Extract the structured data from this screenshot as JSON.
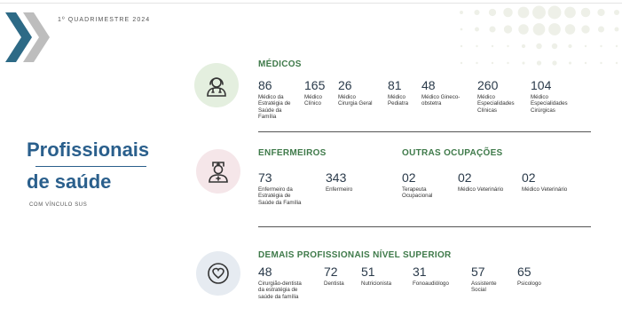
{
  "header": {
    "period": "1º QUADRIMESTRE 2024"
  },
  "title": {
    "line1": "Profissionais",
    "line2": "de saúde",
    "subtitle": "COM VÍNCULO SUS"
  },
  "colors": {
    "title_blue": "#2a5f8c",
    "section_green": "#3f7a4a",
    "icon_bg_green": "#e4efdf",
    "icon_bg_pink": "#f5e6e9",
    "icon_bg_blue": "#e6ebf1"
  },
  "icons": {
    "medicos": "doctor-icon",
    "enfermeiros": "nurse-icon",
    "demais": "heart-icon"
  },
  "medicos": {
    "title": "MÉDICOS",
    "stats": [
      {
        "value": "86",
        "label": "Médico da\nEstratégia de\nSaúde da\nFamília"
      },
      {
        "value": "165",
        "label": "Médico\nClínico"
      },
      {
        "value": "26",
        "label": "Médico\nCirurgia Geral"
      },
      {
        "value": "81",
        "label": "Médico\nPediatra"
      },
      {
        "value": "48",
        "label": "Médico Gineco-\nobstetra"
      },
      {
        "value": "260",
        "label": "Médico\nEspecialidades\nClínicas"
      },
      {
        "value": "104",
        "label": "Médico\nEspecialidades\nCirúrgicas"
      }
    ]
  },
  "enfermeiros": {
    "title": "ENFERMEIROS",
    "stats": [
      {
        "value": "73",
        "label": "Enfermeiro da\nEstratégia de\nSaúde da Família"
      },
      {
        "value": "343",
        "label": "Enfermeiro"
      }
    ]
  },
  "outras": {
    "title": "OUTRAS OCUPAÇÕES",
    "stats": [
      {
        "value": "02",
        "label": "Terapeuta\nOcupacional"
      },
      {
        "value": "02",
        "label": "Médico Veterinário"
      },
      {
        "value": "02",
        "label": "Médico Veterinário"
      }
    ]
  },
  "demais": {
    "title": "DEMAIS PROFISSIONAIS NÍVEL SUPERIOR",
    "stats": [
      {
        "value": "48",
        "label": "Cirurgião-dentista\nda estratégia de\nsaúde da família"
      },
      {
        "value": "72",
        "label": "Dentista"
      },
      {
        "value": "51",
        "label": "Nutricionista"
      },
      {
        "value": "31",
        "label": "Fonoaudiólogo"
      },
      {
        "value": "57",
        "label": "Assistente\nSocial"
      },
      {
        "value": "65",
        "label": "Psicologo"
      }
    ]
  }
}
